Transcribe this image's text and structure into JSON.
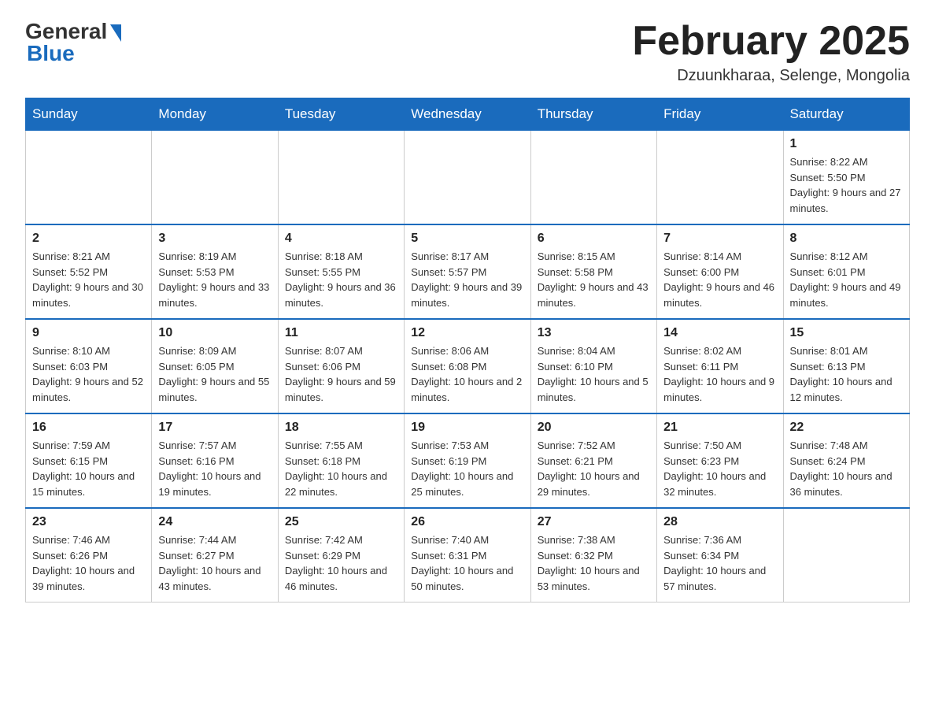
{
  "logo": {
    "general": "General",
    "blue": "Blue"
  },
  "title": "February 2025",
  "subtitle": "Dzuunkharaa, Selenge, Mongolia",
  "days_header": [
    "Sunday",
    "Monday",
    "Tuesday",
    "Wednesday",
    "Thursday",
    "Friday",
    "Saturday"
  ],
  "weeks": [
    [
      {
        "day": "",
        "info": ""
      },
      {
        "day": "",
        "info": ""
      },
      {
        "day": "",
        "info": ""
      },
      {
        "day": "",
        "info": ""
      },
      {
        "day": "",
        "info": ""
      },
      {
        "day": "",
        "info": ""
      },
      {
        "day": "1",
        "info": "Sunrise: 8:22 AM\nSunset: 5:50 PM\nDaylight: 9 hours and 27 minutes."
      }
    ],
    [
      {
        "day": "2",
        "info": "Sunrise: 8:21 AM\nSunset: 5:52 PM\nDaylight: 9 hours and 30 minutes."
      },
      {
        "day": "3",
        "info": "Sunrise: 8:19 AM\nSunset: 5:53 PM\nDaylight: 9 hours and 33 minutes."
      },
      {
        "day": "4",
        "info": "Sunrise: 8:18 AM\nSunset: 5:55 PM\nDaylight: 9 hours and 36 minutes."
      },
      {
        "day": "5",
        "info": "Sunrise: 8:17 AM\nSunset: 5:57 PM\nDaylight: 9 hours and 39 minutes."
      },
      {
        "day": "6",
        "info": "Sunrise: 8:15 AM\nSunset: 5:58 PM\nDaylight: 9 hours and 43 minutes."
      },
      {
        "day": "7",
        "info": "Sunrise: 8:14 AM\nSunset: 6:00 PM\nDaylight: 9 hours and 46 minutes."
      },
      {
        "day": "8",
        "info": "Sunrise: 8:12 AM\nSunset: 6:01 PM\nDaylight: 9 hours and 49 minutes."
      }
    ],
    [
      {
        "day": "9",
        "info": "Sunrise: 8:10 AM\nSunset: 6:03 PM\nDaylight: 9 hours and 52 minutes."
      },
      {
        "day": "10",
        "info": "Sunrise: 8:09 AM\nSunset: 6:05 PM\nDaylight: 9 hours and 55 minutes."
      },
      {
        "day": "11",
        "info": "Sunrise: 8:07 AM\nSunset: 6:06 PM\nDaylight: 9 hours and 59 minutes."
      },
      {
        "day": "12",
        "info": "Sunrise: 8:06 AM\nSunset: 6:08 PM\nDaylight: 10 hours and 2 minutes."
      },
      {
        "day": "13",
        "info": "Sunrise: 8:04 AM\nSunset: 6:10 PM\nDaylight: 10 hours and 5 minutes."
      },
      {
        "day": "14",
        "info": "Sunrise: 8:02 AM\nSunset: 6:11 PM\nDaylight: 10 hours and 9 minutes."
      },
      {
        "day": "15",
        "info": "Sunrise: 8:01 AM\nSunset: 6:13 PM\nDaylight: 10 hours and 12 minutes."
      }
    ],
    [
      {
        "day": "16",
        "info": "Sunrise: 7:59 AM\nSunset: 6:15 PM\nDaylight: 10 hours and 15 minutes."
      },
      {
        "day": "17",
        "info": "Sunrise: 7:57 AM\nSunset: 6:16 PM\nDaylight: 10 hours and 19 minutes."
      },
      {
        "day": "18",
        "info": "Sunrise: 7:55 AM\nSunset: 6:18 PM\nDaylight: 10 hours and 22 minutes."
      },
      {
        "day": "19",
        "info": "Sunrise: 7:53 AM\nSunset: 6:19 PM\nDaylight: 10 hours and 25 minutes."
      },
      {
        "day": "20",
        "info": "Sunrise: 7:52 AM\nSunset: 6:21 PM\nDaylight: 10 hours and 29 minutes."
      },
      {
        "day": "21",
        "info": "Sunrise: 7:50 AM\nSunset: 6:23 PM\nDaylight: 10 hours and 32 minutes."
      },
      {
        "day": "22",
        "info": "Sunrise: 7:48 AM\nSunset: 6:24 PM\nDaylight: 10 hours and 36 minutes."
      }
    ],
    [
      {
        "day": "23",
        "info": "Sunrise: 7:46 AM\nSunset: 6:26 PM\nDaylight: 10 hours and 39 minutes."
      },
      {
        "day": "24",
        "info": "Sunrise: 7:44 AM\nSunset: 6:27 PM\nDaylight: 10 hours and 43 minutes."
      },
      {
        "day": "25",
        "info": "Sunrise: 7:42 AM\nSunset: 6:29 PM\nDaylight: 10 hours and 46 minutes."
      },
      {
        "day": "26",
        "info": "Sunrise: 7:40 AM\nSunset: 6:31 PM\nDaylight: 10 hours and 50 minutes."
      },
      {
        "day": "27",
        "info": "Sunrise: 7:38 AM\nSunset: 6:32 PM\nDaylight: 10 hours and 53 minutes."
      },
      {
        "day": "28",
        "info": "Sunrise: 7:36 AM\nSunset: 6:34 PM\nDaylight: 10 hours and 57 minutes."
      },
      {
        "day": "",
        "info": ""
      }
    ]
  ]
}
